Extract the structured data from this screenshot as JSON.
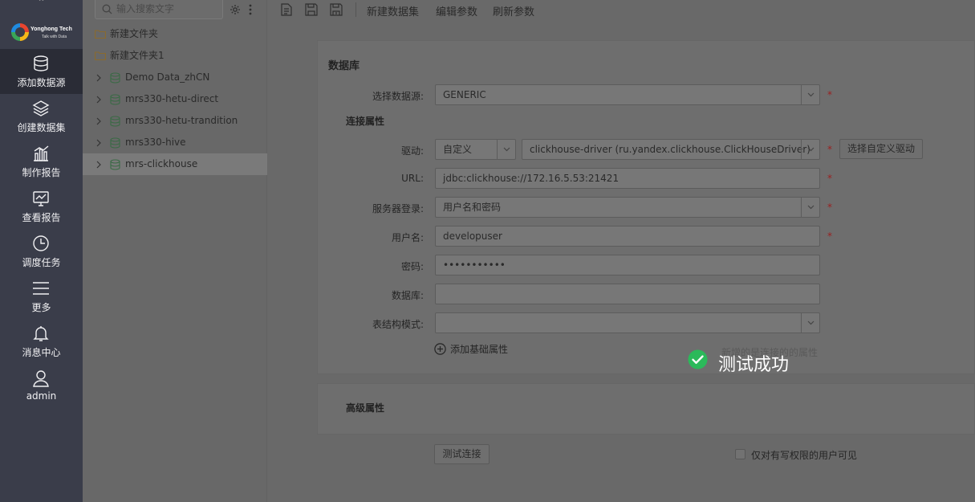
{
  "colors": {
    "nav_bg": "#3a3d4a",
    "nav_active": "#2a2c36",
    "overlay": "#6a6a6a",
    "required": "#9a2020",
    "success": "#2bb95a",
    "logo_ring": [
      "#e8442e",
      "#f5b718",
      "#3aa657",
      "#1f8be0"
    ]
  },
  "logo": {
    "name": "Yonghong Tech",
    "tagline": "Talk with Data"
  },
  "nav": [
    {
      "label": "添加数据源",
      "icon": "database-icon",
      "active": true
    },
    {
      "label": "创建数据集",
      "icon": "layers-icon"
    },
    {
      "label": "制作报告",
      "icon": "bar-chart-icon"
    },
    {
      "label": "查看报告",
      "icon": "monitor-chart-icon"
    },
    {
      "label": "调度任务",
      "icon": "clock-icon"
    },
    {
      "label": "更多",
      "icon": "menu-icon"
    },
    {
      "label": "消息中心",
      "icon": "bell-icon"
    },
    {
      "label": "admin",
      "icon": "user-icon"
    }
  ],
  "tree": {
    "search_placeholder": "输入搜索文字",
    "items": [
      {
        "type": "folder",
        "label": "新建文件夹"
      },
      {
        "type": "folder",
        "label": "新建文件夹1"
      },
      {
        "type": "datasource",
        "label": "Demo Data_zhCN"
      },
      {
        "type": "datasource",
        "label": "mrs330-hetu-direct"
      },
      {
        "type": "datasource",
        "label": "mrs330-hetu-trandition"
      },
      {
        "type": "datasource",
        "label": "mrs330-hive"
      },
      {
        "type": "datasource",
        "label": "mrs-clickhouse",
        "selected": true
      }
    ]
  },
  "toolbar": {
    "new_dataset": "新建数据集",
    "edit_params": "编辑参数",
    "refresh_params": "刷新参数"
  },
  "form": {
    "section_title": "数据库",
    "connection_title": "连接属性",
    "advanced_title": "高级属性",
    "required_mark": "*",
    "datasource_label": "选择数据源:",
    "datasource_value": "GENERIC",
    "driver_label": "驱动:",
    "driver_type": "自定义",
    "driver_value": "clickhouse-driver (ru.yandex.clickhouse.ClickHouseDriver)",
    "custom_driver_button": "选择自定义驱动",
    "url_label": "URL:",
    "url_value": "jdbc:clickhouse://172.16.5.53:21421",
    "server_login_label": "服务器登录:",
    "server_login_value": "用户名和密码",
    "username_label": "用户名:",
    "username_value": "developuser",
    "password_label": "密码:",
    "password_value": "•••••••••••",
    "database_label": "数据库:",
    "database_value": "",
    "schema_label": "表结构模式:",
    "schema_value": "",
    "add_basic_prop": "添加基础属性",
    "faded_note": "新增的是连接的的属性"
  },
  "footer": {
    "test_button": "测试连接",
    "visible_checkbox": "仅对有写权限的用户可见"
  },
  "toast": {
    "message": "测试成功"
  }
}
